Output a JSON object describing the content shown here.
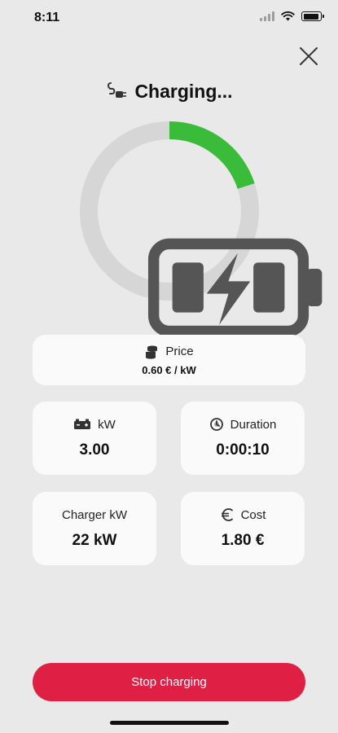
{
  "status_bar": {
    "time": "8:11"
  },
  "header": {
    "title": "Charging..."
  },
  "progress": {
    "fraction": 0.2,
    "track_color": "#d6d6d6",
    "fill_color": "#3bbb3a"
  },
  "price": {
    "label": "Price",
    "value": "0.60 € / kW"
  },
  "stats": {
    "kw": {
      "label": "kW",
      "value": "3.00"
    },
    "duration": {
      "label": "Duration",
      "value": "0:00:10"
    },
    "charger_kw": {
      "label": "Charger kW",
      "value": "22 kW"
    },
    "cost": {
      "label": "Cost",
      "value": "1.80 €"
    }
  },
  "actions": {
    "stop_label": "Stop charging"
  },
  "colors": {
    "accent": "#e01f45",
    "background": "#e9e9e9",
    "card": "#fafafa"
  },
  "icons": [
    "signal-icon",
    "wifi-icon",
    "battery-status-icon",
    "close-icon",
    "plug-icon",
    "charging-battery-icon",
    "coins-icon",
    "car-battery-icon",
    "clock-icon",
    "euro-icon"
  ]
}
